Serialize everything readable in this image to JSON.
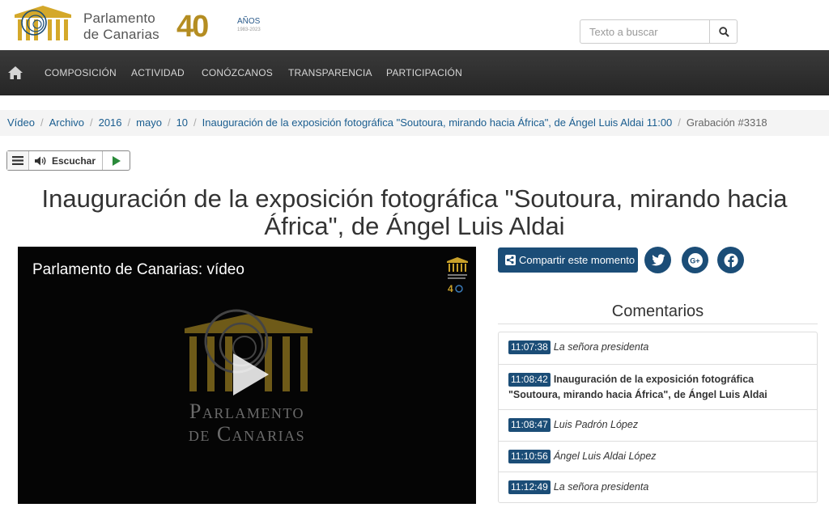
{
  "header": {
    "logo_line1": "Parlamento",
    "logo_line2": "de Canarias",
    "anniv_number": "40",
    "anniv_label": "AÑOS",
    "anniv_years": "1983-2023",
    "search_placeholder": "Texto a buscar"
  },
  "nav": {
    "items": [
      {
        "label": "COMPOSICIÓN"
      },
      {
        "label": "ACTIVIDAD"
      },
      {
        "label": "CONÓZCANOS"
      },
      {
        "label": "TRANSPARENCIA"
      },
      {
        "label": "PARTICIPACIÓN"
      }
    ]
  },
  "breadcrumb": {
    "items": [
      {
        "label": "Vídeo"
      },
      {
        "label": "Archivo"
      },
      {
        "label": "2016"
      },
      {
        "label": "mayo"
      },
      {
        "label": "10"
      },
      {
        "label": "Inauguración de la exposición fotográfica \"Soutoura, mirando hacia África\", de Ángel Luis Aldai 11:00"
      }
    ],
    "current": "Grabación #3318"
  },
  "listen": {
    "label": "Escuchar"
  },
  "page": {
    "title": "Inauguración de la exposición fotográfica \"Soutoura, mirando hacia África\", de Ángel Luis Aldai"
  },
  "video": {
    "title": "Parlamento de Canarias: vídeo",
    "brand_line1": "Parlamento",
    "brand_line2": "de Canarias"
  },
  "share": {
    "label": "Compartir este momento"
  },
  "comments": {
    "title": "Comentarios",
    "items": [
      {
        "time": "11:07:38",
        "text": "La señora presidenta",
        "style": "italic"
      },
      {
        "time": "11:08:42",
        "text": "Inauguración de la exposición fotográfica \"Soutoura, mirando hacia África\", de Ángel Luis Aldai",
        "style": "bold"
      },
      {
        "time": "11:08:47",
        "text": "Luis Padrón López",
        "style": "italic"
      },
      {
        "time": "11:10:56",
        "text": "Ángel Luis Aldai López",
        "style": "italic"
      },
      {
        "time": "11:12:49",
        "text": "La señora presidenta",
        "style": "italic"
      }
    ]
  },
  "colors": {
    "brand_blue": "#1b4d77",
    "gold": "#b48d22",
    "nav_bg": "#2e2e2e",
    "link": "#1a5d8f"
  },
  "icons": [
    "home-icon",
    "search-icon",
    "menu-icon",
    "speaker-icon",
    "play-icon",
    "share-icon",
    "twitter-icon",
    "google-plus-icon",
    "facebook-icon"
  ]
}
